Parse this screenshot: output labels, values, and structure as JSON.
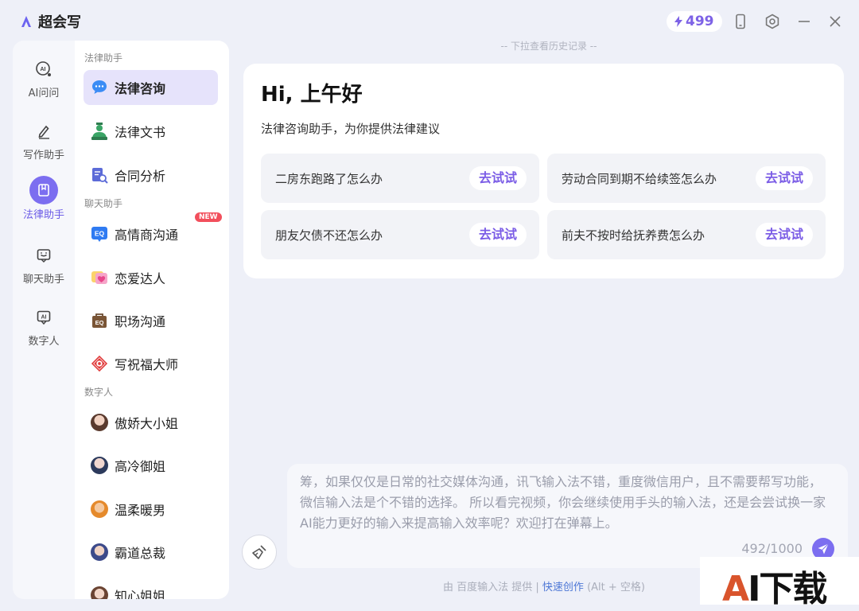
{
  "app": {
    "title": "超会写",
    "points": "499"
  },
  "rail": [
    {
      "label": "AI问问",
      "icon": "ai-chat-icon"
    },
    {
      "label": "写作助手",
      "icon": "pen-icon"
    },
    {
      "label": "法律助手",
      "icon": "document-icon",
      "active": true
    },
    {
      "label": "聊天助手",
      "icon": "chat-bubble-icon"
    },
    {
      "label": "数字人",
      "icon": "ai-avatar-icon"
    }
  ],
  "menu": {
    "group_legal": "法律助手",
    "legal_items": [
      {
        "label": "法律咨询",
        "icon": "consult-bubble-icon",
        "active": true
      },
      {
        "label": "法律文书",
        "icon": "lawyer-icon"
      },
      {
        "label": "合同分析",
        "icon": "contract-search-icon"
      }
    ],
    "group_chat": "聊天助手",
    "chat_items": [
      {
        "label": "高情商沟通",
        "icon": "eq-icon",
        "badge": "NEW"
      },
      {
        "label": "恋爱达人",
        "icon": "heart-icon"
      },
      {
        "label": "职场沟通",
        "icon": "briefcase-icon"
      },
      {
        "label": "写祝福大师",
        "icon": "blessing-icon"
      }
    ],
    "group_digital": "数字人",
    "digital_items": [
      {
        "label": "傲娇大小姐",
        "icon": "avatar"
      },
      {
        "label": "高冷御姐",
        "icon": "avatar"
      },
      {
        "label": "温柔暖男",
        "icon": "avatar"
      },
      {
        "label": "霸道总裁",
        "icon": "avatar"
      },
      {
        "label": "知心姐姐",
        "icon": "avatar"
      }
    ]
  },
  "history_hint": "-- 下拉查看历史记录 --",
  "welcome": {
    "greeting": "Hi, 上午好",
    "subtitle": "法律咨询助手，为你提供法律建议",
    "try_label": "去试试",
    "cards": [
      "二房东跑路了怎么办",
      "劳动合同到期不给续签怎么办",
      "朋友欠债不还怎么办",
      "前夫不按时给抚养费怎么办"
    ]
  },
  "composer": {
    "text": "筹，如果仅仅是日常的社交媒体沟通，讯飞输入法不错，重度微信用户，且不需要帮写功能，微信输入法是个不错的选择。 所以看完视频，你会继续使用手头的输入法，还是会尝试换一家AI能力更好的输入来提高输入效率呢？欢迎打在弹幕上。",
    "counter": "492/1000"
  },
  "footer": {
    "prefix": "由 百度输入法 提供 |",
    "link": "快速创作",
    "suffix": "(Alt + 空格)"
  },
  "watermark": {
    "a": "A",
    "rest": "I下载"
  },
  "colors": {
    "accent": "#7c6ef0",
    "try_text": "#7b5de6",
    "badge": "#f24f5c"
  }
}
